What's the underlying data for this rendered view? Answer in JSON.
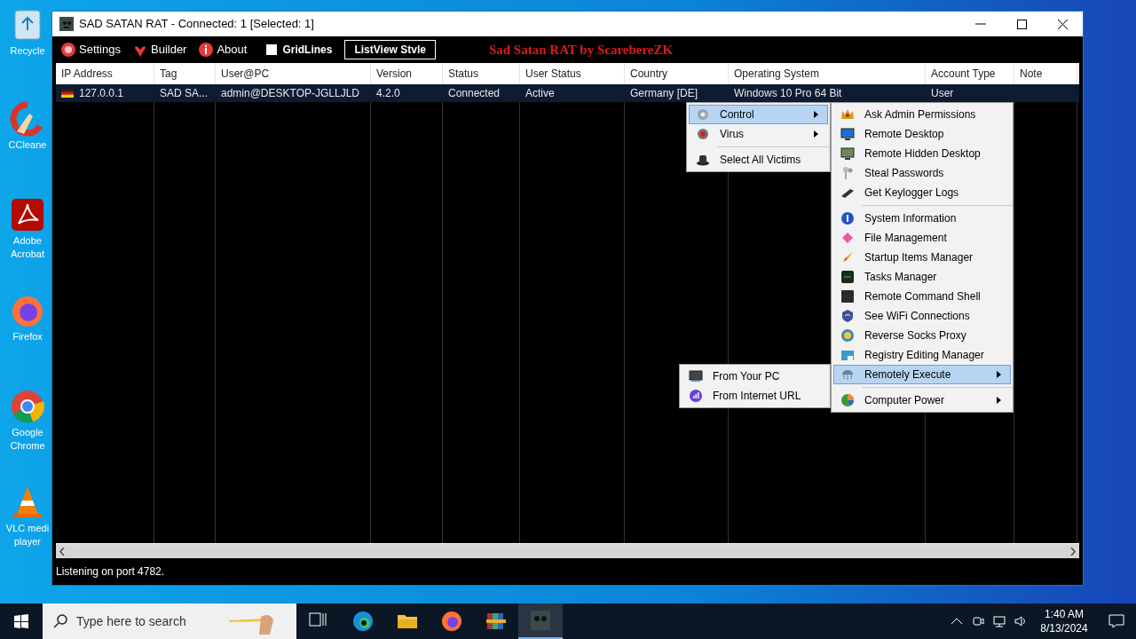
{
  "desktop_icons": [
    {
      "lines": [
        "Recycle"
      ]
    },
    {
      "lines": [
        "CCleane"
      ]
    },
    {
      "lines": [
        "Adobe",
        "Acrobat"
      ]
    },
    {
      "lines": [
        "Firefox"
      ]
    },
    {
      "lines": [
        "Google",
        "Chrome"
      ]
    },
    {
      "lines": [
        "VLC medi",
        "player"
      ]
    }
  ],
  "window": {
    "title": "SAD SATAN RAT - Connected: 1 [Selected: 1]"
  },
  "toolbar": {
    "buttons": [
      "Settings",
      "Builder",
      "About"
    ],
    "gridlines": {
      "label": "GridLines",
      "checked": false
    },
    "style_button": "ListView Stvle",
    "banner": "Sad Satan RAT by ScarebereZK"
  },
  "table": {
    "columns": [
      "IP Address",
      "Tag",
      "User@PC",
      "Version",
      "Status",
      "User Status",
      "Country",
      "Operating System",
      "Account Type",
      "Note"
    ],
    "rows": [
      {
        "selected": true,
        "cells": [
          "127.0.0.1",
          "SAD SA...",
          "admin@DESKTOP-JGLLJLD",
          "4.2.0",
          "Connected",
          "Active",
          "Germany [DE]",
          "Windows 10 Pro 64 Bit",
          "User",
          ""
        ]
      }
    ]
  },
  "context_menu": {
    "items": [
      {
        "kind": "item",
        "label": "Control",
        "selected": true,
        "submenu": true
      },
      {
        "kind": "item",
        "label": "Virus",
        "selected": false,
        "submenu": true
      },
      {
        "kind": "separator"
      },
      {
        "kind": "item",
        "label": "Select All Victims",
        "selected": false,
        "submenu": false
      }
    ]
  },
  "control_menu": {
    "items": [
      {
        "kind": "item",
        "label": "Ask Admin Permissions",
        "selected": false,
        "submenu": false
      },
      {
        "kind": "item",
        "label": "Remote Desktop",
        "selected": false,
        "submenu": false
      },
      {
        "kind": "item",
        "label": "Remote Hidden Desktop",
        "selected": false,
        "submenu": false
      },
      {
        "kind": "item",
        "label": "Steal Passwords",
        "selected": false,
        "submenu": false
      },
      {
        "kind": "item",
        "label": "Get Keylogger Logs",
        "selected": false,
        "submenu": false
      },
      {
        "kind": "separator"
      },
      {
        "kind": "item",
        "label": "System Information",
        "selected": false,
        "submenu": false
      },
      {
        "kind": "item",
        "label": "File Management",
        "selected": false,
        "submenu": false
      },
      {
        "kind": "item",
        "label": "Startup Items Manager",
        "selected": false,
        "submenu": false
      },
      {
        "kind": "item",
        "label": "Tasks Manager",
        "selected": false,
        "submenu": false
      },
      {
        "kind": "item",
        "label": "Remote Command Shell",
        "selected": false,
        "submenu": false
      },
      {
        "kind": "item",
        "label": "See WiFi Connections",
        "selected": false,
        "submenu": false
      },
      {
        "kind": "item",
        "label": "Reverse Socks Proxy",
        "selected": false,
        "submenu": false
      },
      {
        "kind": "item",
        "label": "Registry Editing Manager",
        "selected": false,
        "submenu": false
      },
      {
        "kind": "item",
        "label": "Remotely Execute",
        "selected": true,
        "submenu": true
      },
      {
        "kind": "separator"
      },
      {
        "kind": "item",
        "label": "Computer Power",
        "selected": false,
        "submenu": true
      }
    ]
  },
  "execute_menu": {
    "items": [
      {
        "kind": "item",
        "label": "From Your PC",
        "selected": false,
        "submenu": false
      },
      {
        "kind": "item",
        "label": "From Internet URL",
        "selected": false,
        "submenu": false
      }
    ]
  },
  "status_bar": "Listening on port 4782.",
  "taskbar": {
    "search_placeholder": "Type here to search",
    "time": "1:40 AM",
    "date": "8/13/2024"
  }
}
